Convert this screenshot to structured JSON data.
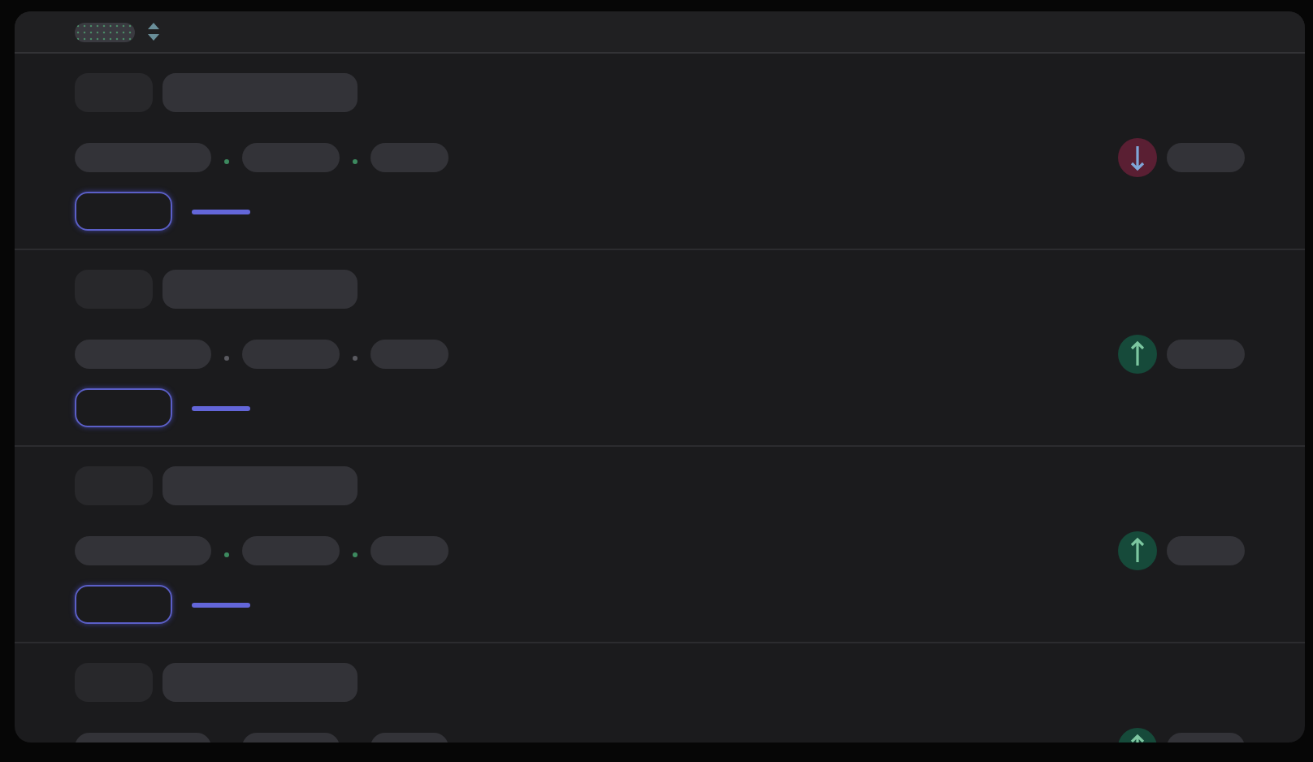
{
  "rows": [
    {
      "kind": "down",
      "color": "#3d8a5f"
    },
    {
      "kind": "up",
      "color": "#5a5a60"
    },
    {
      "kind": "up",
      "color": "#3d8a5f"
    },
    {
      "kind": "up"
    }
  ]
}
